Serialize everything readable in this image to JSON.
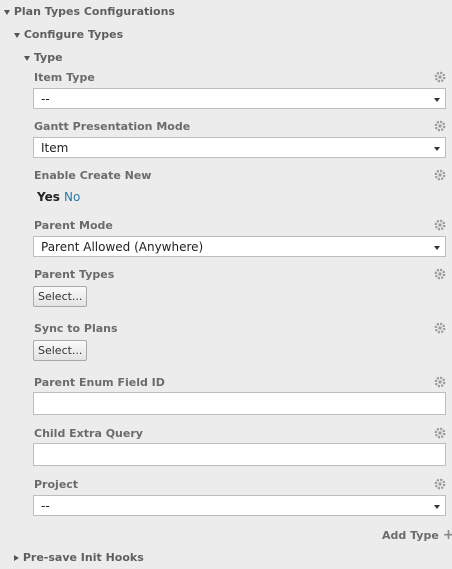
{
  "tree": {
    "plan_types": "Plan Types Configurations",
    "configure_types": "Configure Types",
    "type": "Type",
    "pre_save": "Pre-save Init Hooks"
  },
  "fields": {
    "item_type": {
      "label": "Item Type",
      "value": "--"
    },
    "gantt_mode": {
      "label": "Gantt Presentation Mode",
      "value": "Item"
    },
    "enable_create": {
      "label": "Enable Create New",
      "yes": "Yes",
      "no": "No"
    },
    "parent_mode": {
      "label": "Parent Mode",
      "value": "Parent Allowed (Anywhere)"
    },
    "parent_types": {
      "label": "Parent Types",
      "button": "Select..."
    },
    "sync_plans": {
      "label": "Sync to Plans",
      "button": "Select..."
    },
    "parent_enum": {
      "label": "Parent Enum Field ID",
      "value": ""
    },
    "child_query": {
      "label": "Child Extra Query",
      "value": ""
    },
    "project": {
      "label": "Project",
      "value": "--"
    }
  },
  "add_type": "Add Type",
  "icons": {
    "gear": "gear-icon",
    "plus": "plus-icon",
    "expanded": "triangle-down-icon",
    "collapsed": "triangle-right-icon"
  },
  "colors": {
    "background": "#ececec",
    "link": "#2a7aa8",
    "label": "#6b6b6b"
  }
}
